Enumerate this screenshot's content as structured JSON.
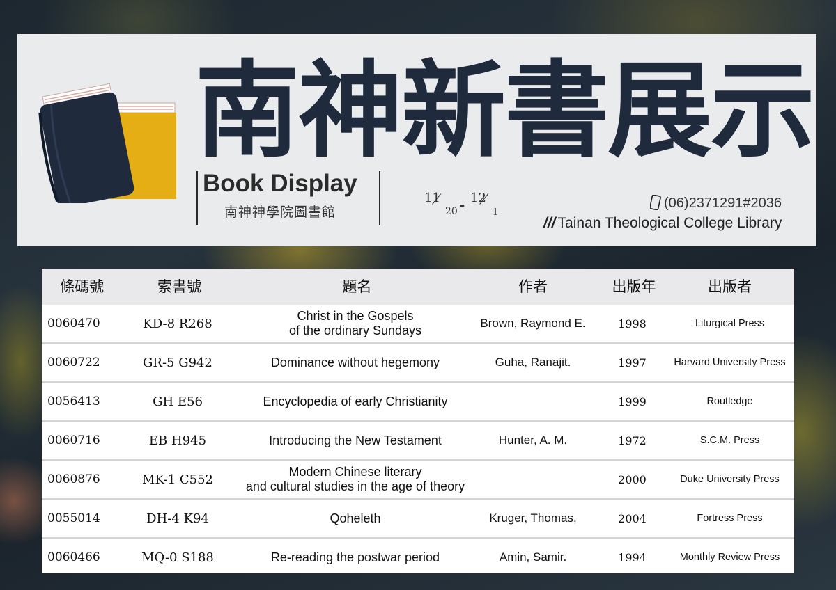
{
  "banner": {
    "title_cn": "南神新書展示",
    "title_en": "Book Display",
    "library_cn": "南神神學院圖書館",
    "dates": {
      "start_month": "11",
      "start_day": "20",
      "separator": "-",
      "end_month": "12",
      "end_day": "1"
    },
    "phone": "(06)2371291#2036",
    "library_en": "Tainan Theological College Library"
  },
  "colors": {
    "navy": "#1f2a3d",
    "gold": "#e5ae14",
    "banner_bg": "#e9ebed"
  },
  "table": {
    "headers": {
      "barcode": "條碼號",
      "call_number": "索書號",
      "title": "題名",
      "author": "作者",
      "year": "出版年",
      "publisher": "出版者"
    },
    "rows": [
      {
        "barcode": "0060470",
        "call_number": "KD-8 R268",
        "title_line1": "Christ in the Gospels",
        "title_line2": "of the ordinary Sundays",
        "author": "Brown, Raymond E.",
        "year": "1998",
        "publisher": "Liturgical Press"
      },
      {
        "barcode": "0060722",
        "call_number": "GR-5 G942",
        "title_line1": "Dominance without hegemony",
        "title_line2": "",
        "author": "Guha, Ranajit.",
        "year": "1997",
        "publisher": "Harvard University Press"
      },
      {
        "barcode": "0056413",
        "call_number": "GH E56",
        "title_line1": "Encyclopedia of early Christianity",
        "title_line2": "",
        "author": "",
        "year": "1999",
        "publisher": "Routledge"
      },
      {
        "barcode": "0060716",
        "call_number": "EB H945",
        "title_line1": "Introducing the New Testament",
        "title_line2": "",
        "author": "Hunter, A. M.",
        "year": "1972",
        "publisher": "S.C.M. Press"
      },
      {
        "barcode": "0060876",
        "call_number": "MK-1 C552",
        "title_line1": "Modern Chinese literary",
        "title_line2": "and cultural studies in the age of theory",
        "author": "",
        "year": "2000",
        "publisher": "Duke University Press"
      },
      {
        "barcode": "0055014",
        "call_number": "DH-4 K94",
        "title_line1": "Qoheleth",
        "title_line2": "",
        "author": "Kruger, Thomas,",
        "year": "2004",
        "publisher": "Fortress Press"
      },
      {
        "barcode": "0060466",
        "call_number": "MQ-0 S188",
        "title_line1": "Re-reading the postwar period",
        "title_line2": "",
        "author": "Amin, Samir.",
        "year": "1994",
        "publisher": "Monthly Review Press"
      }
    ]
  }
}
